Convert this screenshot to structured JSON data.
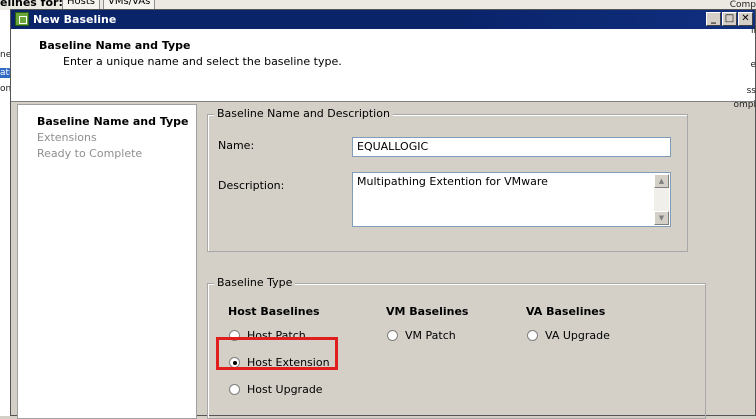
{
  "background": {
    "label": "elines for:",
    "tabs": [
      "Hosts",
      "VMs/VAs"
    ],
    "right_text": [
      "Comp",
      "il",
      "e",
      "ss",
      "ompi"
    ],
    "left_text": [
      "ne",
      "ati",
      "on-"
    ]
  },
  "dialog": {
    "title": "New Baseline",
    "window_buttons": {
      "minimize": "_",
      "maximize": "□",
      "close": "✕"
    },
    "header": {
      "title": "Baseline Name and Type",
      "subtitle": "Enter a unique name and select the baseline type."
    },
    "nav": [
      {
        "label": "Baseline Name and Type",
        "active": true
      },
      {
        "label": "Extensions",
        "active": false
      },
      {
        "label": "Ready to Complete",
        "active": false
      }
    ],
    "name_group": {
      "legend": "Baseline Name and Description",
      "name_label": "Name:",
      "name_value": "EQUALLOGIC",
      "description_label": "Description:",
      "description_value": "Multipathing Extention for VMware"
    },
    "type_group": {
      "legend": "Baseline Type",
      "host": {
        "heading": "Host Baselines",
        "options": [
          {
            "label": "Host Patch",
            "checked": false
          },
          {
            "label": "Host Extension",
            "checked": true
          },
          {
            "label": "Host Upgrade",
            "checked": false
          }
        ]
      },
      "vm": {
        "heading": "VM Baselines",
        "options": [
          {
            "label": "VM Patch",
            "checked": false
          }
        ]
      },
      "va": {
        "heading": "VA Baselines",
        "options": [
          {
            "label": "VA Upgrade",
            "checked": false
          }
        ]
      }
    }
  }
}
